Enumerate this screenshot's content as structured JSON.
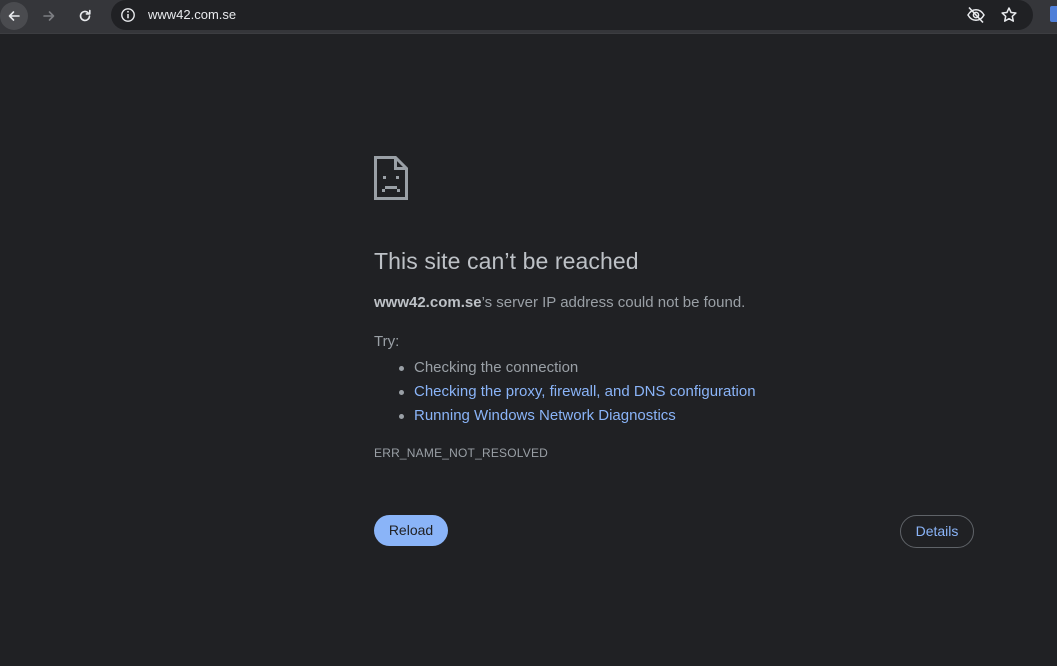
{
  "browser": {
    "url": "www42.com.se",
    "icons": [
      "back-icon",
      "forward-icon",
      "reload-icon",
      "info-icon",
      "eye-off-icon",
      "star-icon"
    ]
  },
  "error_page": {
    "heading": "This site can’t be reached",
    "host": "www42.com.se",
    "summary_suffix": "’s server IP address could not be found.",
    "try_label": "Try:",
    "suggestions": [
      {
        "label": "Checking the connection",
        "link": false
      },
      {
        "label": "Checking the proxy, firewall, and DNS configuration",
        "link": true
      },
      {
        "label": "Running Windows Network Diagnostics",
        "link": true
      }
    ],
    "error_code": "ERR_NAME_NOT_RESOLVED",
    "reload_label": "Reload",
    "details_label": "Details"
  },
  "colors": {
    "background": "#202124",
    "link": "#8ab4f8",
    "text": "#9aa0a6"
  }
}
